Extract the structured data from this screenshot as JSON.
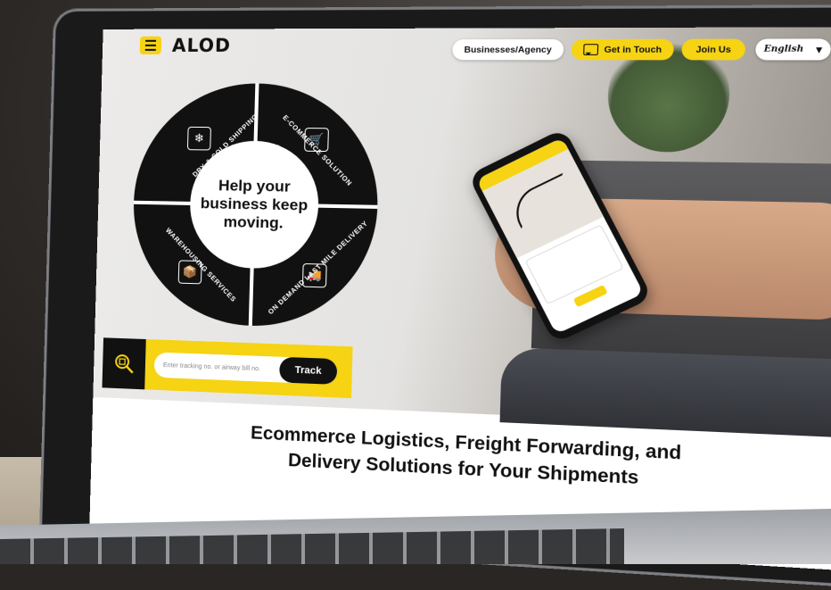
{
  "brand": {
    "logo_text": "ALOD",
    "accent_color": "#f6d313"
  },
  "header": {
    "menu_icon": "hamburger-menu-icon",
    "buttons": {
      "business": "Businesses/Agency",
      "get_in_touch": "Get in Touch",
      "join_us": "Join Us",
      "language": "English"
    }
  },
  "hero": {
    "tagline": "Help your business keep moving.",
    "services": [
      {
        "label": "DRY & COLD SHIPPING",
        "icon": "cold-shipping-icon"
      },
      {
        "label": "E-COMMERCE SOLUTION",
        "icon": "ecommerce-icon"
      },
      {
        "label": "ON DEMAND LAST MILE DELIVERY",
        "icon": "delivery-icon"
      },
      {
        "label": "WAREHOUSING SERVICES",
        "icon": "warehouse-icon"
      }
    ],
    "tracking": {
      "placeholder": "Enter tracking no. or airway bill no.",
      "button": "Track",
      "icon": "tracking-search-icon"
    }
  },
  "headline": {
    "line1": "Ecommerce Logistics, Freight Forwarding, and",
    "line2": "Delivery Solutions for Your Shipments"
  }
}
